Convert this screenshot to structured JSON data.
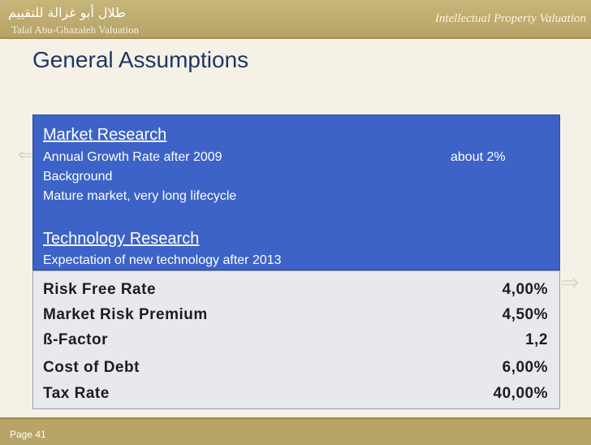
{
  "header": {
    "arabic_name": "طلال أبو غزالة للتقييم",
    "firm_name": "Talal Abu-Ghazaleh Valuation",
    "tagline": "Intellectual Property Valuation"
  },
  "slide": {
    "title": "General Assumptions"
  },
  "market_box": {
    "heading_market": "Market Research",
    "growth_label": "Annual Growth Rate after 2009",
    "growth_value": "about 2%",
    "background_label": "Background",
    "background_text": "Mature market, very long lifecycle",
    "heading_tech": "Technology Research",
    "tech_text": "Expectation of new technology after 2013"
  },
  "assumptions": [
    {
      "label": "Risk Free Rate",
      "value": "4,00%"
    },
    {
      "label": "Market Risk Premium",
      "value": "4,50%"
    },
    {
      "label": "ß-Factor",
      "value": "1,2"
    },
    {
      "label": "Cost of Debt",
      "value": "6,00%"
    },
    {
      "label": "Tax Rate",
      "value": "40,00%"
    }
  ],
  "footer": {
    "page_label": "Page 41"
  }
}
